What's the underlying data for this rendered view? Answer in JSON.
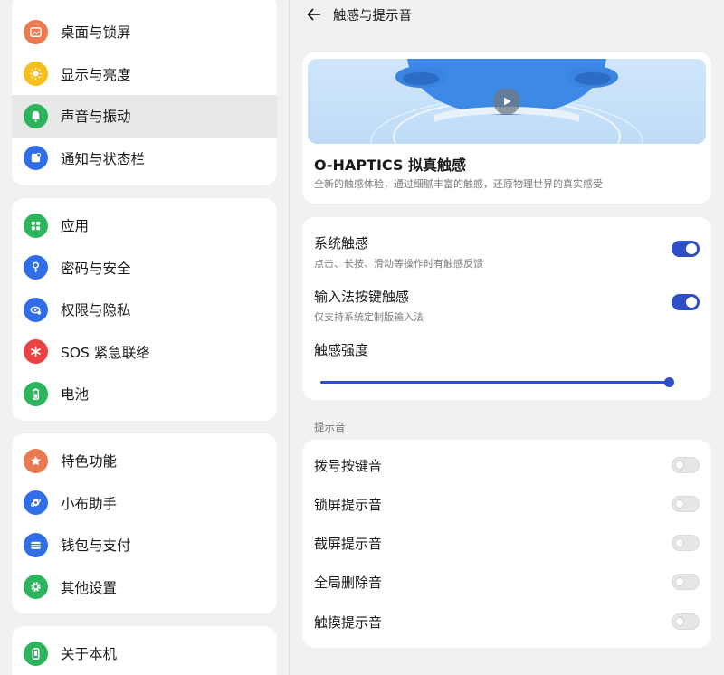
{
  "sidebar": {
    "group1": [
      {
        "label": "桌面与锁屏",
        "icon": "wallpaper-icon",
        "color": "#ea7a50"
      },
      {
        "label": "显示与亮度",
        "icon": "sun-icon",
        "color": "#f5c01d"
      },
      {
        "label": "声音与振动",
        "icon": "bell-icon",
        "color": "#2db55d",
        "active": true
      },
      {
        "label": "通知与状态栏",
        "icon": "notification-icon",
        "color": "#2f6ee8"
      }
    ],
    "group2": [
      {
        "label": "应用",
        "icon": "apps-icon",
        "color": "#2db55d"
      },
      {
        "label": "密码与安全",
        "icon": "key-icon",
        "color": "#2f6ee8"
      },
      {
        "label": "权限与隐私",
        "icon": "privacy-icon",
        "color": "#2f6ee8"
      },
      {
        "label": "SOS 紧急联络",
        "icon": "sos-icon",
        "color": "#e94343"
      },
      {
        "label": "电池",
        "icon": "battery-icon",
        "color": "#2db55d"
      }
    ],
    "group3": [
      {
        "label": "特色功能",
        "icon": "star-icon",
        "color": "#ea7a50"
      },
      {
        "label": "小布助手",
        "icon": "assistant-icon",
        "color": "#2f6ee8"
      },
      {
        "label": "钱包与支付",
        "icon": "wallet-icon",
        "color": "#2f6ee8"
      },
      {
        "label": "其他设置",
        "icon": "gear-icon",
        "color": "#2db55d"
      }
    ],
    "group4": [
      {
        "label": "关于本机",
        "icon": "phone-icon",
        "color": "#2db55d"
      }
    ]
  },
  "header": {
    "title": "触感与提示音"
  },
  "haptics_card": {
    "title": "O-HAPTICS 拟真触感",
    "description": "全新的触感体验，通过细腻丰富的触感，还原物理世界的真实感受"
  },
  "haptics_settings": {
    "system": {
      "title": "系统触感",
      "subtitle": "点击、长按、滑动等操作时有触感反馈",
      "enabled": true
    },
    "ime": {
      "title": "输入法按键触感",
      "subtitle": "仅支持系统定制版输入法",
      "enabled": true
    },
    "intensity": {
      "title": "触感强度",
      "value": 1.0
    }
  },
  "sounds": {
    "section_label": "提示音",
    "items": [
      {
        "label": "拨号按键音",
        "enabled": false
      },
      {
        "label": "锁屏提示音",
        "enabled": false
      },
      {
        "label": "截屏提示音",
        "enabled": false
      },
      {
        "label": "全局删除音",
        "enabled": false
      },
      {
        "label": "触摸提示音",
        "enabled": false
      }
    ]
  },
  "colors": {
    "accent": "#2e4fc7"
  }
}
